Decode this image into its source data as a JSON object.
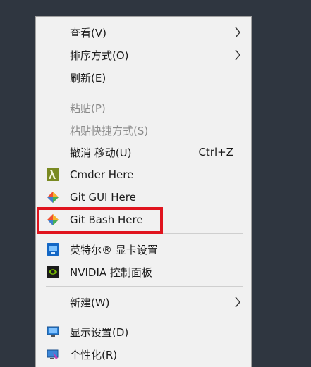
{
  "menu": {
    "view": {
      "label": "查看(V)",
      "icon": "chevron-right-icon"
    },
    "sort": {
      "label": "排序方式(O)",
      "icon": "chevron-right-icon"
    },
    "refresh": {
      "label": "刷新(E)"
    },
    "paste": {
      "label": "粘贴(P)",
      "disabled": true
    },
    "paste_shortcut": {
      "label": "粘贴快捷方式(S)",
      "disabled": true
    },
    "undo_move": {
      "label": "撤消 移动(U)",
      "shortcut": "Ctrl+Z"
    },
    "cmder": {
      "label": "Cmder Here",
      "icon": "cmder-lambda-icon"
    },
    "git_gui": {
      "label": "Git GUI Here",
      "icon": "git-diamond-icon"
    },
    "git_bash": {
      "label": "Git Bash Here",
      "icon": "git-diamond-icon"
    },
    "intel_graphics": {
      "label": "英特尔® 显卡设置",
      "icon": "intel-graphics-icon"
    },
    "nvidia": {
      "label": "NVIDIA 控制面板",
      "icon": "nvidia-icon"
    },
    "new": {
      "label": "新建(W)",
      "icon": "chevron-right-icon"
    },
    "display": {
      "label": "显示设置(D)",
      "icon": "display-icon"
    },
    "personalize": {
      "label": "个性化(R)",
      "icon": "personalize-icon"
    }
  },
  "colors": {
    "desktop_bg": "#2f3640",
    "menu_bg": "#f1f1f1",
    "highlight_border": "#e0141e",
    "disabled_text": "#8a8a8a"
  }
}
